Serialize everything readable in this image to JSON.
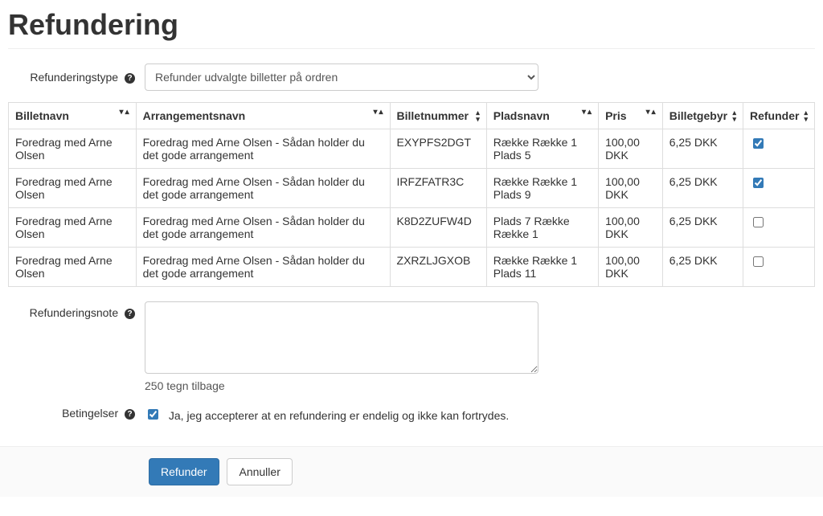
{
  "page": {
    "title": "Refundering"
  },
  "form": {
    "type_label": "Refunderingstype",
    "type_value": "Refunder udvalgte billetter på ordren",
    "note_label": "Refunderingsnote",
    "note_value": "",
    "note_counter": "250 tegn tilbage",
    "terms_label": "Betingelser",
    "terms_text": "Ja, jeg accepterer at en refundering er endelig og ikke kan fortrydes.",
    "terms_checked": true
  },
  "table": {
    "headers": {
      "ticket_name": "Billetnavn",
      "arrangement": "Arrangementsnavn",
      "ticket_number": "Billetnummer",
      "seat": "Pladsnavn",
      "price": "Pris",
      "fee": "Billetgebyr",
      "refund": "Refunder"
    },
    "rows": [
      {
        "ticket_name": "Foredrag med Arne Olsen",
        "arrangement": "Foredrag med Arne Olsen - Sådan holder du det gode arrangement",
        "ticket_number": "EXYPFS2DGT",
        "seat": "Række Række 1 Plads 5",
        "price": "100,00 DKK",
        "fee": "6,25 DKK",
        "refund": true
      },
      {
        "ticket_name": "Foredrag med Arne Olsen",
        "arrangement": "Foredrag med Arne Olsen - Sådan holder du det gode arrangement",
        "ticket_number": "IRFZFATR3C",
        "seat": "Række Række 1 Plads 9",
        "price": "100,00 DKK",
        "fee": "6,25 DKK",
        "refund": true
      },
      {
        "ticket_name": "Foredrag med Arne Olsen",
        "arrangement": "Foredrag med Arne Olsen - Sådan holder du det gode arrangement",
        "ticket_number": "K8D2ZUFW4D",
        "seat": "Plads 7 Række Række 1",
        "price": "100,00 DKK",
        "fee": "6,25 DKK",
        "refund": false
      },
      {
        "ticket_name": "Foredrag med Arne Olsen",
        "arrangement": "Foredrag med Arne Olsen - Sådan holder du det gode arrangement",
        "ticket_number": "ZXRZLJGXOB",
        "seat": "Række Række 1 Plads 11",
        "price": "100,00 DKK",
        "fee": "6,25 DKK",
        "refund": false
      }
    ]
  },
  "buttons": {
    "submit": "Refunder",
    "cancel": "Annuller"
  }
}
